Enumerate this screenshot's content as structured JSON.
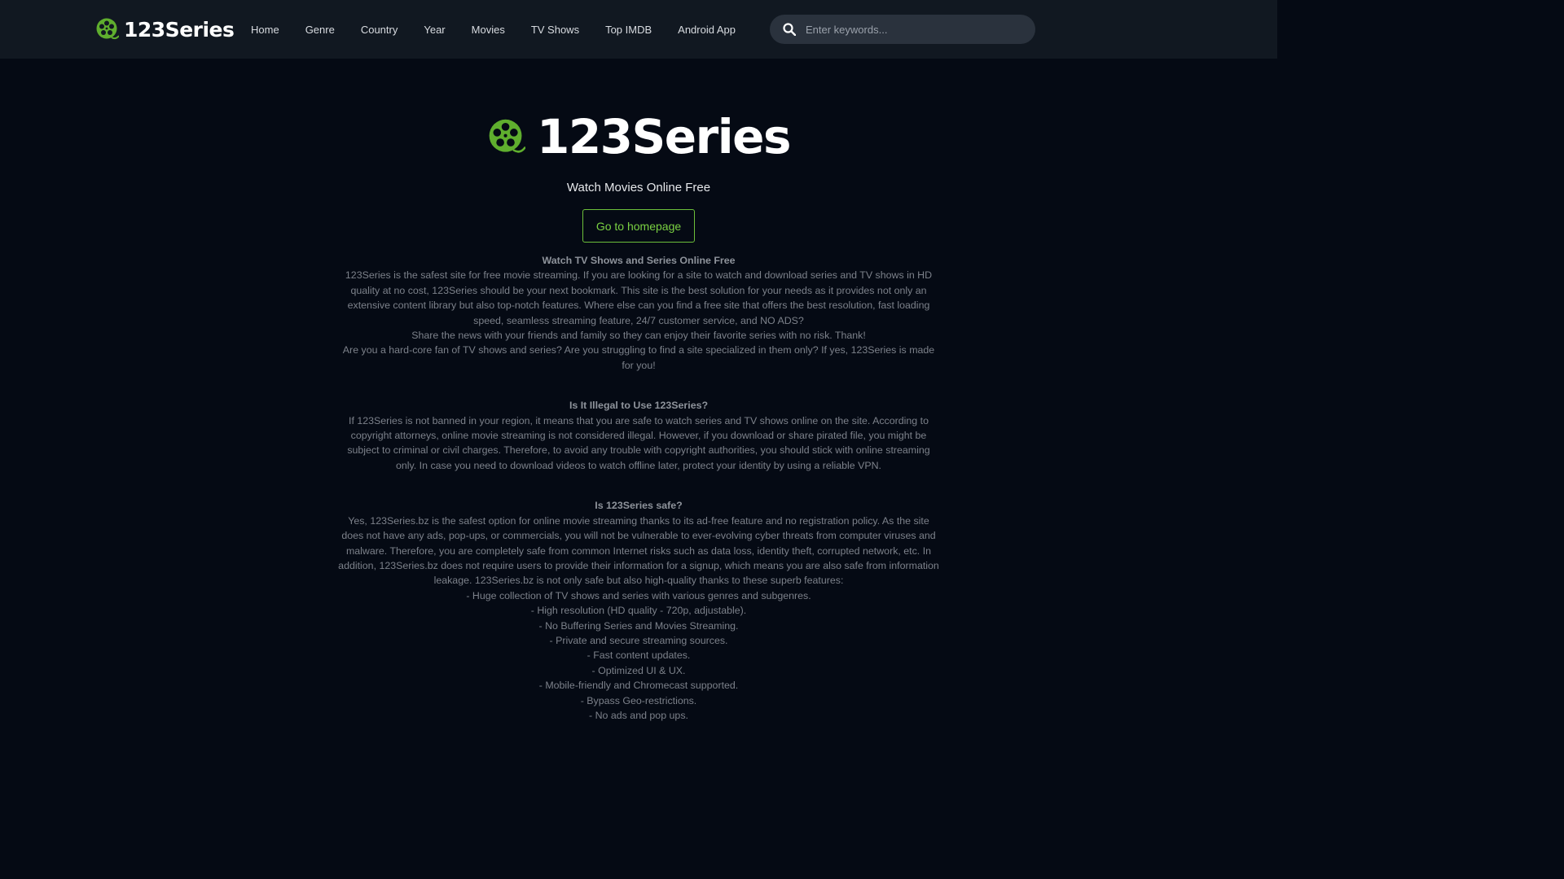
{
  "header": {
    "brand": "123Series",
    "nav": [
      "Home",
      "Genre",
      "Country",
      "Year",
      "Movies",
      "TV Shows",
      "Top IMDB",
      "Android App"
    ],
    "search": {
      "placeholder": "Enter keywords...",
      "value": "",
      "icon": "search-icon"
    }
  },
  "hero": {
    "logo_text": "123Series",
    "tagline": "Watch Movies Online Free",
    "button": "Go to homepage"
  },
  "content": {
    "section1": {
      "heading": "Watch TV Shows and Series Online Free",
      "paragraphs": [
        "123Series is the safest site for free movie streaming. If you are looking for a site to watch and download series and TV shows in HD quality at no cost, 123Series should be your next bookmark. This site is the best solution for your needs as it provides not only an extensive content library but also top-notch features. Where else can you find a free site that offers the best resolution, fast loading speed, seamless streaming feature, 24/7 customer service, and NO ADS?",
        "Share the news with your friends and family so they can enjoy their favorite series with no risk. Thank!",
        "Are you a hard-core fan of TV shows and series? Are you struggling to find a site specialized in them only? If yes, 123Series is made for you!"
      ]
    },
    "section2": {
      "heading": "Is It Illegal to Use 123Series?",
      "paragraphs": [
        "If 123Series is not banned in your region, it means that you are safe to watch series and TV shows online on the site. According to copyright attorneys, online movie streaming is not considered illegal. However, if you download or share pirated file, you might be subject to criminal or civil charges. Therefore, to avoid any trouble with copyright authorities, you should stick with online streaming only. In case you need to download videos to watch offline later, protect your identity by using a reliable VPN."
      ]
    },
    "section3": {
      "heading": "Is 123Series safe?",
      "paragraphs": [
        "Yes, 123Series.bz is the safest option for online movie streaming thanks to its ad-free feature and no registration policy. As the site does not have any ads, pop-ups, or commercials, you will not be vulnerable to ever-evolving cyber threats from computer viruses and malware. Therefore, you are completely safe from common Internet risks such as data loss, identity theft, corrupted network, etc. In addition, 123Series.bz does not require users to provide their information for a signup, which means you are also safe from information leakage. 123Series.bz is not only safe but also high-quality thanks to these superb features:",
        "- Huge collection of TV shows and series with various genres and subgenres.",
        "- High resolution (HD quality - 720p, adjustable).",
        "- No Buffering Series and Movies Streaming.",
        "- Private and secure streaming sources.",
        "- Fast content updates.",
        "- Optimized UI & UX.",
        "- Mobile-friendly and Chromecast supported.",
        "- Bypass Geo-restrictions.",
        "- No ads and pop ups."
      ]
    }
  },
  "colors": {
    "background": "#050a14",
    "header": "#111821",
    "accent": "#6cbf3a",
    "logo_green": "#5fae2e"
  }
}
